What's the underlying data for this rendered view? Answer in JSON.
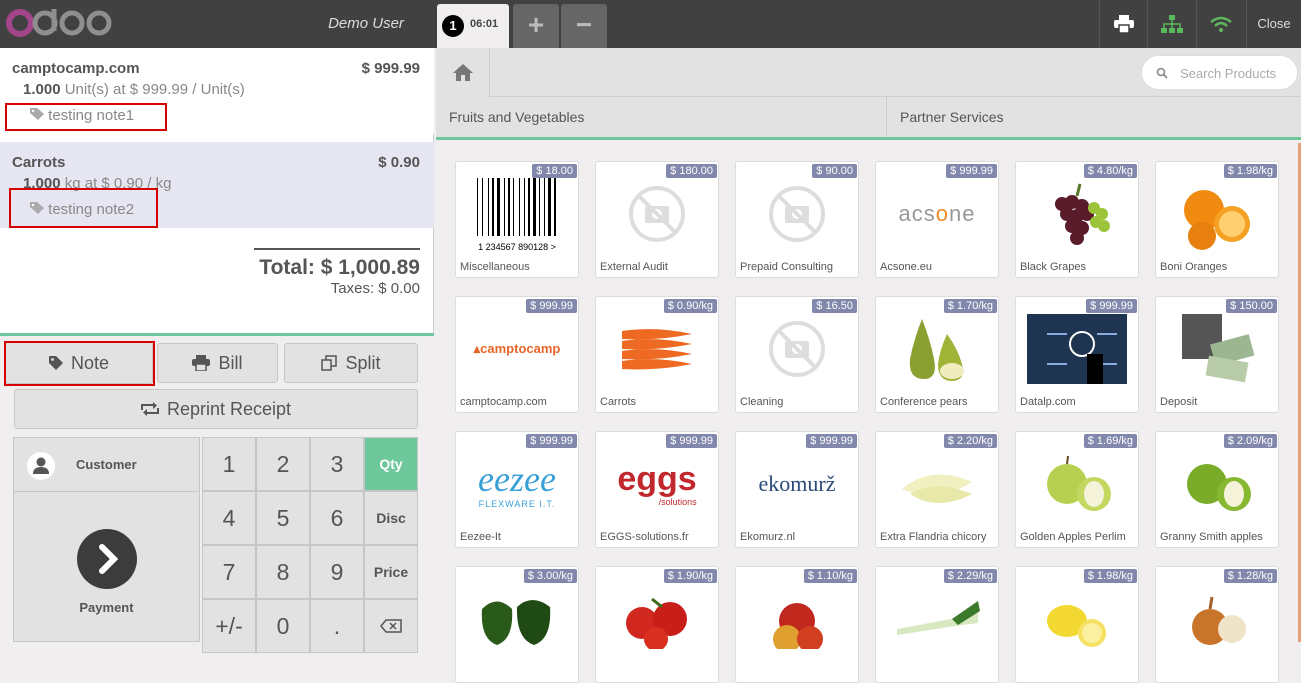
{
  "header": {
    "user": "Demo User",
    "order_number": "1",
    "order_time": "06:01",
    "add_label": "+",
    "remove_label": "−",
    "close_label": "Close"
  },
  "order": {
    "lines": [
      {
        "name": "camptocamp.com",
        "price": "$ 999.99",
        "qty": "1.000",
        "info": "Unit(s) at $ 999.99 / Unit(s)",
        "note": "testing note1"
      },
      {
        "name": "Carrots",
        "price": "$ 0.90",
        "qty": "1.000",
        "info": "kg at $ 0.90 / kg",
        "note": "testing note2"
      }
    ],
    "total": "Total: $ 1,000.89",
    "taxes": "Taxes: $ 0.00"
  },
  "actions": {
    "note": "Note",
    "bill": "Bill",
    "split": "Split",
    "reprint": "Reprint Receipt"
  },
  "pad": {
    "customer": "Customer",
    "payment": "Payment",
    "keys": [
      "1",
      "2",
      "3",
      "4",
      "5",
      "6",
      "7",
      "8",
      "9",
      "+/-",
      "0",
      "."
    ],
    "modes": [
      "Qty",
      "Disc",
      "Price"
    ]
  },
  "search": {
    "placeholder": "Search Products"
  },
  "categories": [
    "Fruits and Vegetables",
    "Partner Services"
  ],
  "products": [
    {
      "name": "Miscellaneous",
      "price": "$ 18.00",
      "img": "barcode"
    },
    {
      "name": "External Audit",
      "price": "$ 180.00",
      "img": "noimage"
    },
    {
      "name": "Prepaid Consulting",
      "price": "$ 90.00",
      "img": "noimage"
    },
    {
      "name": "Acsone.eu",
      "price": "$ 999.99",
      "img": "acsone-logo"
    },
    {
      "name": "Black Grapes",
      "price": "$ 4.80/kg",
      "img": "grapes"
    },
    {
      "name": "Boni Oranges",
      "price": "$ 1.98/kg",
      "img": "oranges"
    },
    {
      "name": "camptocamp.com",
      "price": "$ 999.99",
      "img": "camptocamp-logo"
    },
    {
      "name": "Carrots",
      "price": "$ 0.90/kg",
      "img": "carrots"
    },
    {
      "name": "Cleaning",
      "price": "$ 16.50",
      "img": "noimage"
    },
    {
      "name": "Conference pears",
      "price": "$ 1.70/kg",
      "img": "pears"
    },
    {
      "name": "Datalp.com",
      "price": "$ 999.99",
      "img": "datalp"
    },
    {
      "name": "Deposit",
      "price": "$ 150.00",
      "img": "money"
    },
    {
      "name": "Eezee-It",
      "price": "$ 999.99",
      "img": "eezee-logo"
    },
    {
      "name": "EGGS-solutions.fr",
      "price": "$ 999.99",
      "img": "eggs-logo"
    },
    {
      "name": "Ekomurz.nl",
      "price": "$ 999.99",
      "img": "ekomurz-logo"
    },
    {
      "name": "Extra Flandria chicory",
      "price": "$ 2.20/kg",
      "img": "chicory"
    },
    {
      "name": "Golden Apples Perlim",
      "price": "$ 1.69/kg",
      "img": "golden-apples"
    },
    {
      "name": "Granny Smith apples",
      "price": "$ 2.09/kg",
      "img": "green-apples"
    },
    {
      "name": "",
      "price": "$ 3.00/kg",
      "img": "peppers"
    },
    {
      "name": "",
      "price": "$ 1.90/kg",
      "img": "tomatoes"
    },
    {
      "name": "",
      "price": "$ 1.10/kg",
      "img": "red-apples"
    },
    {
      "name": "",
      "price": "$ 2.29/kg",
      "img": "leek"
    },
    {
      "name": "",
      "price": "$ 1.98/kg",
      "img": "lemons"
    },
    {
      "name": "",
      "price": "$ 1.28/kg",
      "img": "onions"
    }
  ],
  "logo_texts": {
    "barcode_digits": "1 234567 890128 >",
    "acsone": "acsone",
    "camptocamp": "camptocamp",
    "eezee": "eezee",
    "eezee_sub": "FLEXWARE I.T.",
    "eggs": "eggs",
    "eggs_sub": "/solutions",
    "ekomurz": "ekomurž"
  },
  "colors": {
    "accent": "#6ec89b",
    "price_badge": "#8288ac",
    "topbar": "#414141"
  }
}
